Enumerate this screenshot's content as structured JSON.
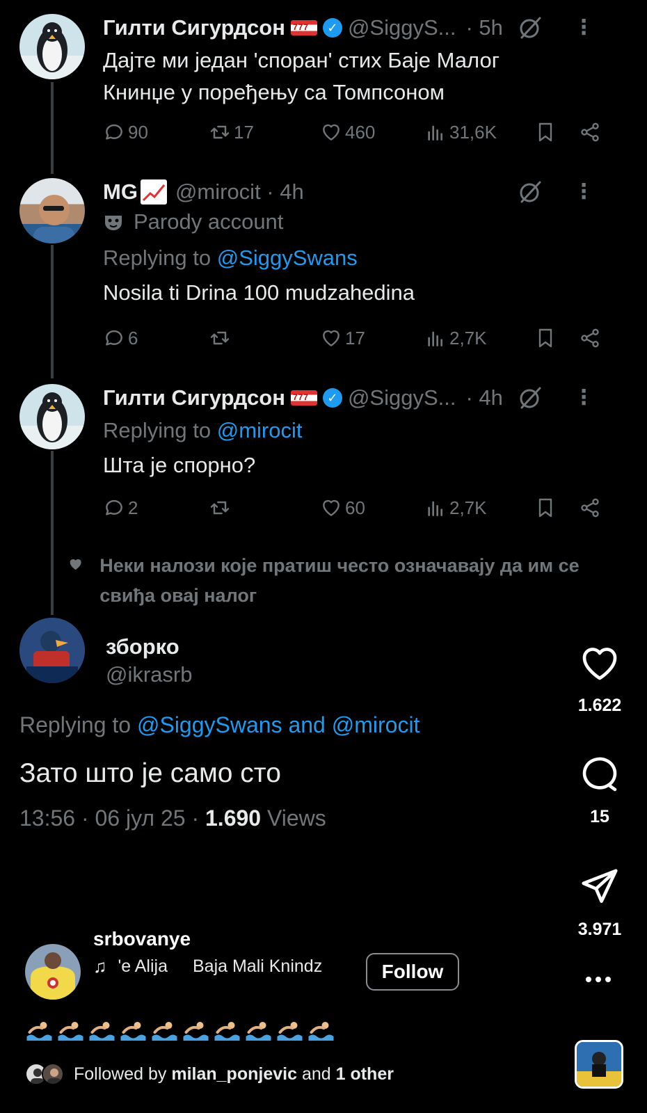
{
  "tweets": [
    {
      "name": "Гилти Сигурдсон",
      "handle": "@SiggyS...",
      "time": "· 5h",
      "text": "Дајте ми један 'споран' стих Баје Малог Книнџе у поређењу са Томпсоном",
      "replies": "90",
      "reposts": "17",
      "likes": "460",
      "views": "31,6K",
      "verified": true
    },
    {
      "name": "MG",
      "handle": "@mirocit · 4h",
      "parody": "Parody account",
      "replying_prefix": "Replying to",
      "replying_to": "@SiggySwans",
      "text": "Nosila ti Drina 100 mudzahedina",
      "replies": "6",
      "reposts": "",
      "likes": "17",
      "views": "2,7K"
    },
    {
      "name": "Гилти Сигурдсон",
      "handle": "@SiggyS...",
      "time": "· 4h",
      "replying_prefix": "Replying to",
      "replying_to": "@mirocit",
      "text": "Шта је спорно?",
      "replies": "2",
      "reposts": "",
      "likes": "60",
      "views": "2,7K",
      "verified": true
    }
  ],
  "liked_note": "Неки налози које пратиш често означавају да им се свиђа овај налог",
  "main_tweet": {
    "name": "зборко",
    "handle": "@ikrasrb",
    "replying_prefix": "Replying to",
    "replying_to": "@SiggySwans and @mirocit",
    "text": "Зато што је само сто",
    "meta_date": "13:56 · 06 јул 25 ·",
    "meta_views": "1.690",
    "meta_views_label": "Views"
  },
  "reel": {
    "likes": "1.622",
    "comments": "15",
    "shares": "3.971",
    "username": "srbovanye",
    "music_1": "'e Alija",
    "music_2": "Baja Mali Knindz",
    "follow_label": "Follow",
    "followed_prefix": "Followed by",
    "followed_user": "milan_ponjevic",
    "followed_and": "and",
    "followed_rest": "1 other",
    "caption_emoji_count": 10
  },
  "colors": {
    "background": "#000000",
    "text": "#e7e9ea",
    "muted": "#71767b",
    "mention": "#1d9bf0",
    "verified": "#1d9bf0"
  },
  "icons": [
    "grok-icon",
    "more-icon",
    "reply-icon",
    "repost-icon",
    "like-icon",
    "views-icon",
    "bookmark-icon",
    "share-icon",
    "heart-icon",
    "comment-icon",
    "send-icon",
    "music-note-icon",
    "more-horizontal-icon"
  ]
}
